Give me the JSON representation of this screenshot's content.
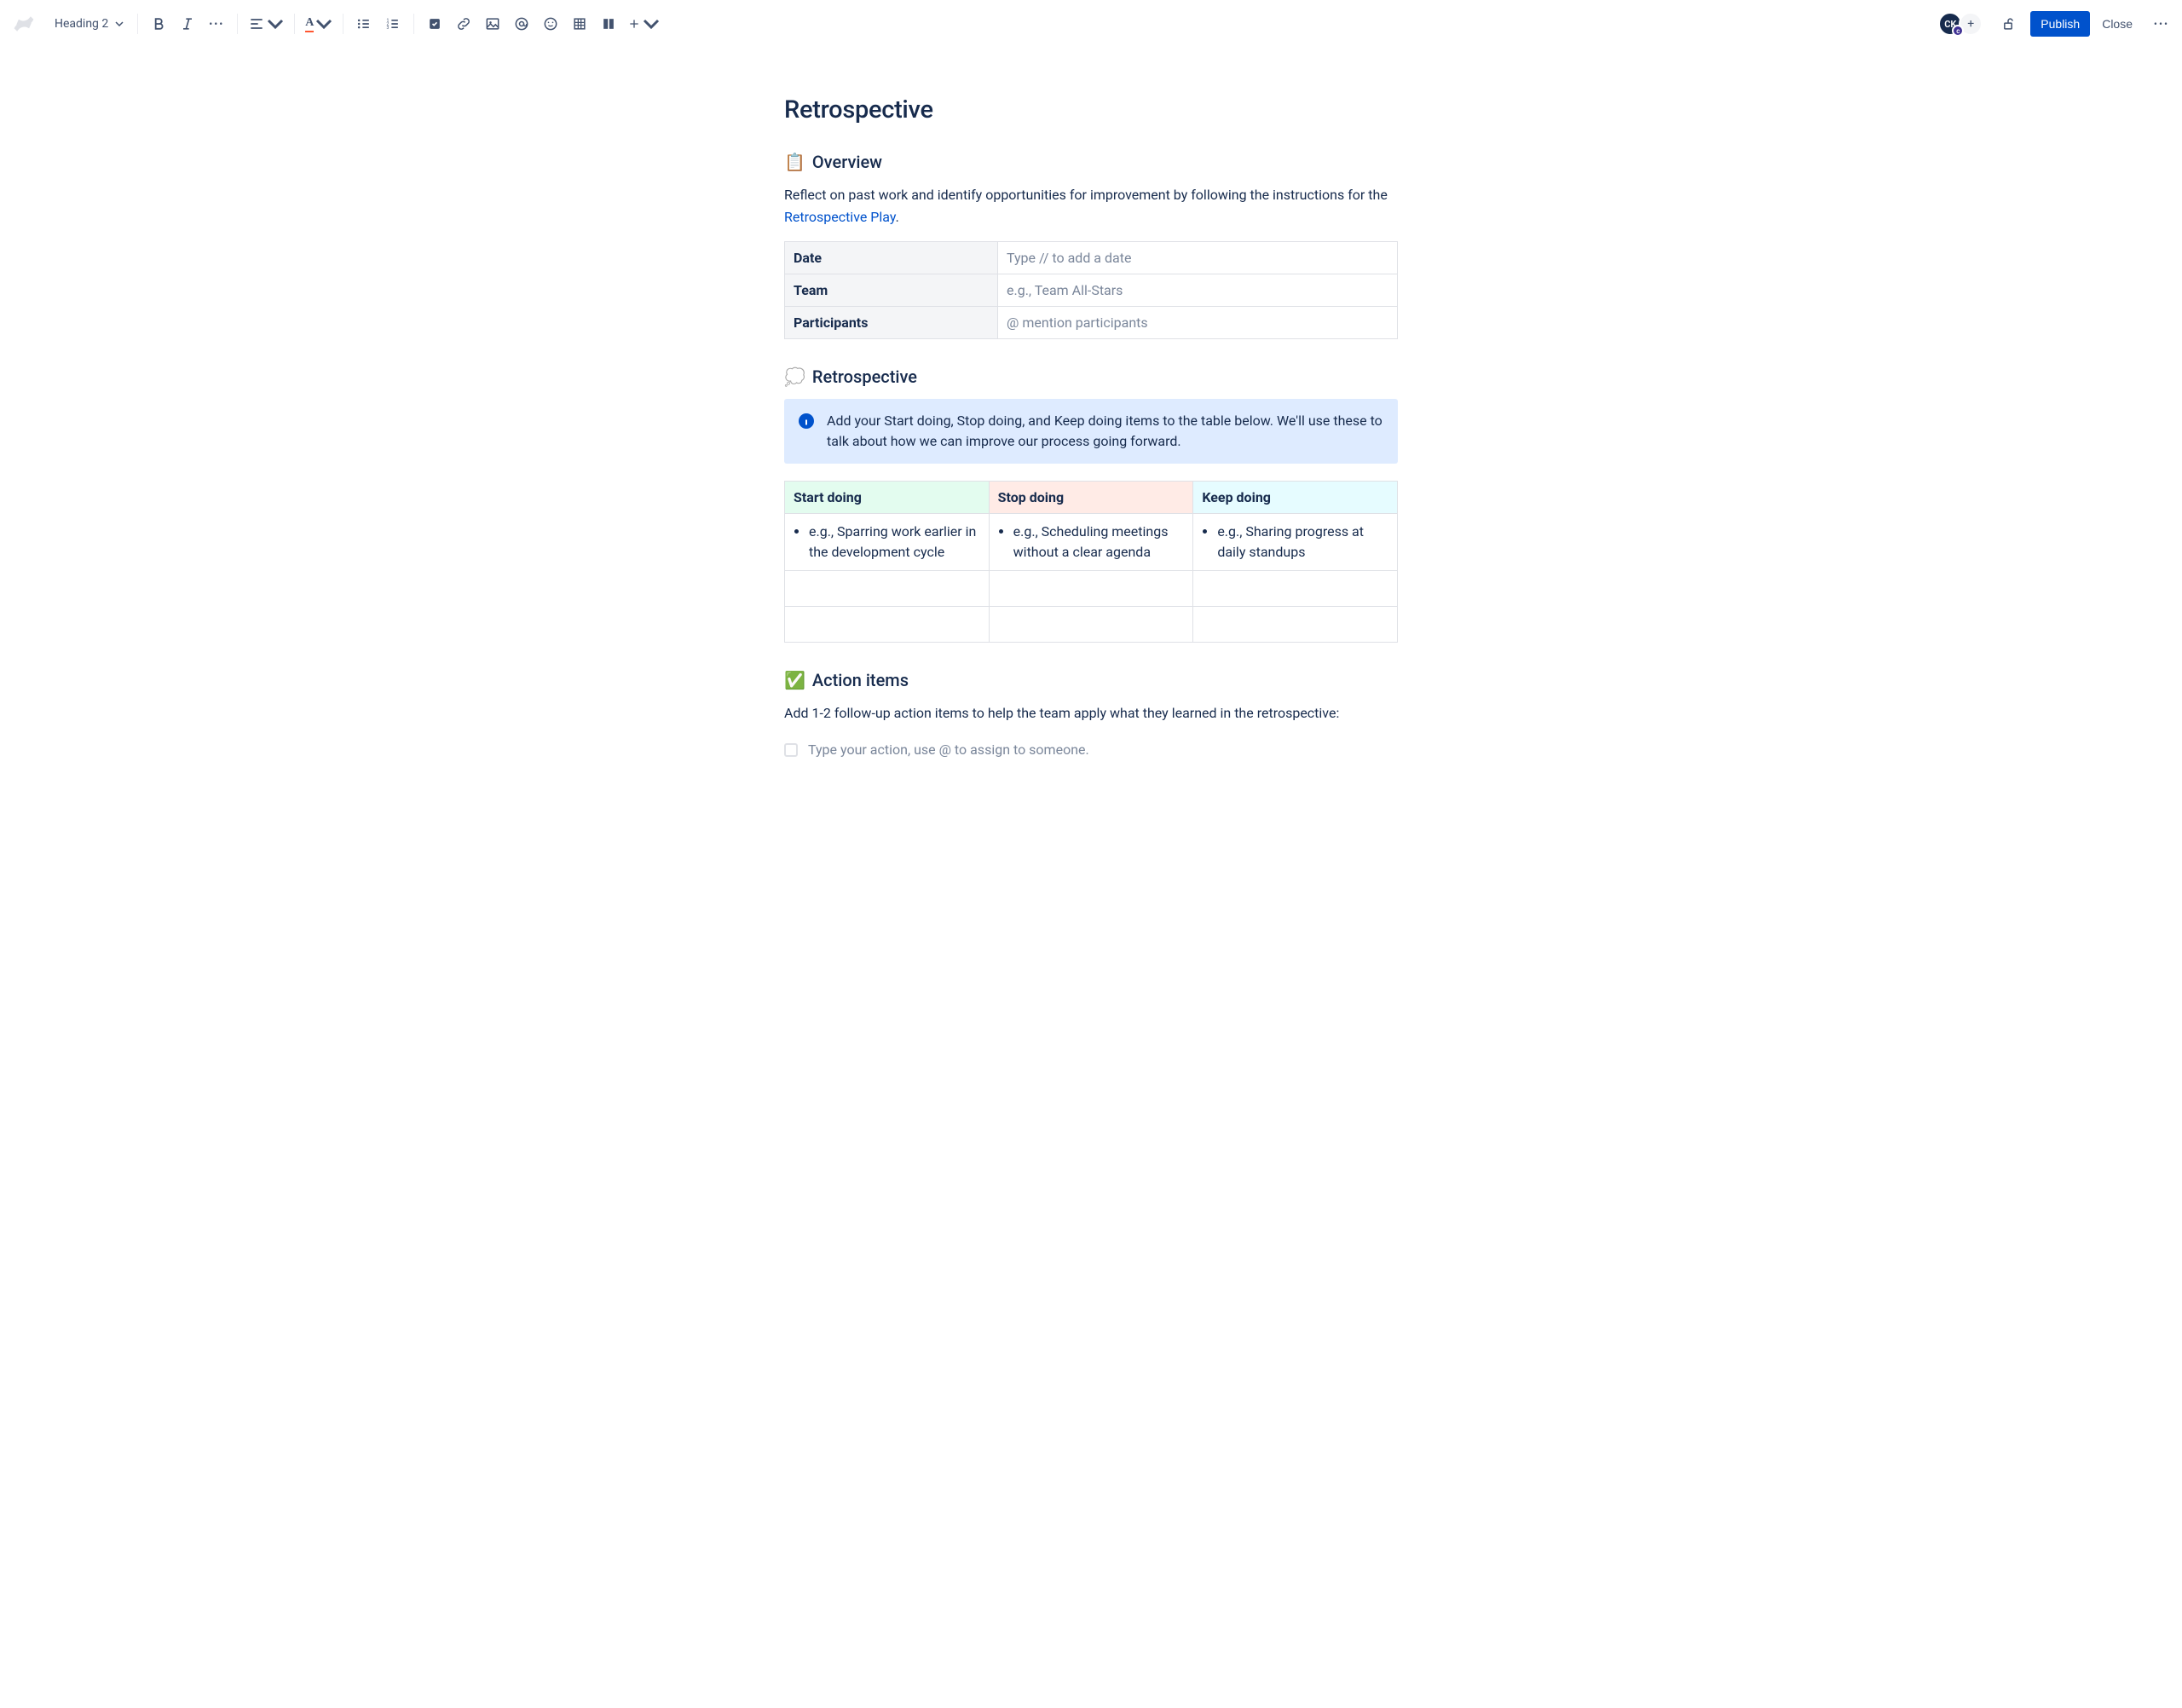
{
  "toolbar": {
    "text_style": "Heading 2",
    "publish_label": "Publish",
    "close_label": "Close",
    "avatar_initials": "CK",
    "avatar_badge": "c"
  },
  "page": {
    "title": "Retrospective"
  },
  "overview": {
    "emoji": "📋",
    "heading": "Overview",
    "intro_before": "Reflect on past work and identify opportunities for improvement by following the instructions for the ",
    "link_text": "Retrospective Play",
    "intro_after": "."
  },
  "info_table": {
    "rows": [
      {
        "label": "Date",
        "value": "Type // to add a date"
      },
      {
        "label": "Team",
        "value": "e.g., Team All-Stars"
      },
      {
        "label": "Participants",
        "value": "@ mention participants"
      }
    ]
  },
  "retro": {
    "emoji": "💭",
    "heading": "Retrospective",
    "panel_text": "Add your Start doing, Stop doing, and Keep doing items to the table below. We'll use these to talk about how we can improve our process going forward.",
    "columns": {
      "start": "Start doing",
      "stop": "Stop doing",
      "keep": "Keep doing"
    },
    "examples": {
      "start": "e.g., Sparring work earlier in the development cycle",
      "stop": "e.g., Scheduling meetings without a clear agenda",
      "keep": "e.g., Sharing progress at daily standups"
    }
  },
  "actions": {
    "emoji": "✅",
    "heading": "Action items",
    "description": "Add 1-2 follow-up action items to help the team apply what they learned in the retrospective:",
    "placeholder": "Type your action, use @ to assign to someone."
  }
}
